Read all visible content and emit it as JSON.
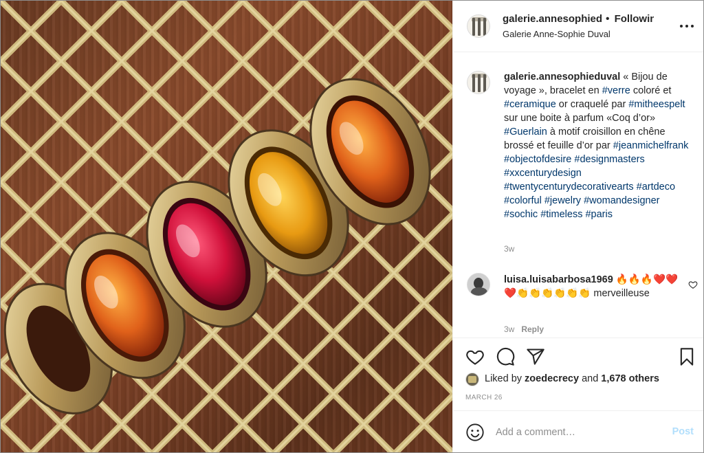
{
  "header": {
    "username": "galerie.annesophieduval",
    "separator": "•",
    "follow_status": "Following",
    "subtitle": "Galerie Anne-Sophie Duval",
    "more_icon": "more-horizontal-icon"
  },
  "caption": {
    "username": "galerie.annesophieduval",
    "segments": [
      {
        "text": " « Bijou de voyage », bracelet en ",
        "tag": false
      },
      {
        "text": "#verre",
        "tag": true
      },
      {
        "text": " coloré et ",
        "tag": false
      },
      {
        "text": "#ceramique",
        "tag": true
      },
      {
        "text": " or craquelé par ",
        "tag": false
      },
      {
        "text": "#mitheespelt",
        "tag": true
      },
      {
        "text": " sur une boite à parfum «Coq d’or» ",
        "tag": false
      },
      {
        "text": "#Guerlain",
        "tag": true
      },
      {
        "text": " à motif croisillon en chêne brossé et feuille d’or par ",
        "tag": false
      },
      {
        "text": "#jeanmichelfrank",
        "tag": true
      },
      {
        "text": " ",
        "tag": false
      },
      {
        "text": "#objectofdesire",
        "tag": true
      },
      {
        "text": " ",
        "tag": false
      },
      {
        "text": "#designmasters",
        "tag": true
      },
      {
        "text": " ",
        "tag": false
      },
      {
        "text": "#xxcenturydesign",
        "tag": true
      },
      {
        "text": " ",
        "tag": false
      },
      {
        "text": "#twentycenturydecorativearts",
        "tag": true
      },
      {
        "text": " ",
        "tag": false
      },
      {
        "text": "#artdeco",
        "tag": true
      },
      {
        "text": " ",
        "tag": false
      },
      {
        "text": "#colorful",
        "tag": true
      },
      {
        "text": " ",
        "tag": false
      },
      {
        "text": "#jewelry",
        "tag": true
      },
      {
        "text": " ",
        "tag": false
      },
      {
        "text": "#womandesigner",
        "tag": true
      },
      {
        "text": " ",
        "tag": false
      },
      {
        "text": "#sochic",
        "tag": true
      },
      {
        "text": " ",
        "tag": false
      },
      {
        "text": "#timeless",
        "tag": true
      },
      {
        "text": " ",
        "tag": false
      },
      {
        "text": "#paris",
        "tag": true
      }
    ],
    "time": "3w"
  },
  "comment": {
    "username": "luisa.luisabarbosa1969",
    "text": " 🔥🔥🔥❤️❤️❤️👏👏👏👏👏👏 merveilleuse",
    "time": "3w",
    "reply_label": "Reply",
    "like_icon": "heart-outline-icon"
  },
  "actions": {
    "like_icon": "heart-outline-icon",
    "comment_icon": "comment-bubble-icon",
    "share_icon": "paper-plane-icon",
    "save_icon": "bookmark-icon"
  },
  "likes": {
    "prefix": "Liked by ",
    "user": "zoedecrecy",
    "middle": " and ",
    "count": "1,678 others"
  },
  "date": "MARCH 26",
  "add_comment": {
    "placeholder": "Add a comment…",
    "post_label": "Post",
    "emoji_icon": "smiley-icon"
  },
  "colors": {
    "link": "#00376b",
    "muted": "#8e8e8e",
    "post_disabled": "#b2dffc",
    "text": "#262626",
    "gold": "#d9c27a",
    "wood": "#7a4026"
  }
}
